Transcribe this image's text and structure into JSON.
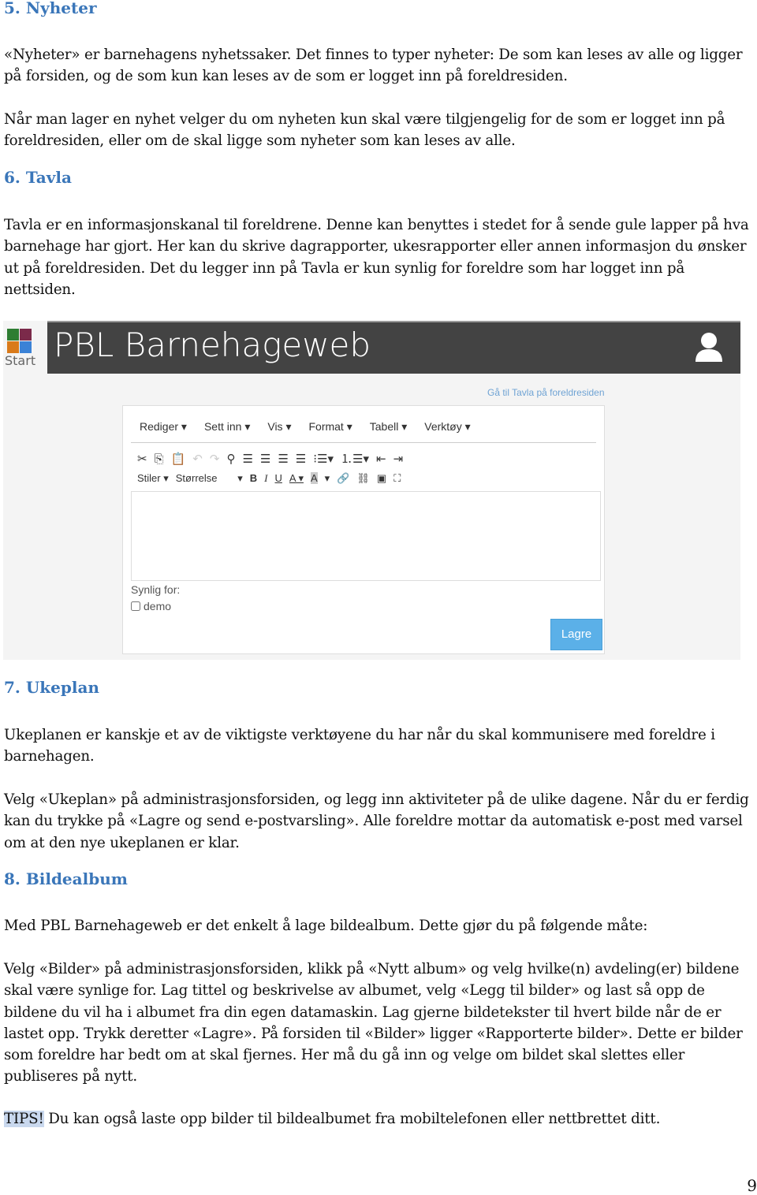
{
  "sections": [
    {
      "heading": "5. Nyheter",
      "paragraphs": [
        "«Nyheter» er barnehagens nyhetssaker. Det finnes to typer nyheter: De som kan leses av alle og ligger på forsiden, og de som kun kan leses av de som er logget inn på foreldresiden.",
        "Når man lager en nyhet velger du om nyheten kun skal være tilgjengelig for de som er logget inn på foreldresiden, eller om de skal ligge som nyheter som kan leses av alle."
      ]
    },
    {
      "heading": "6. Tavla",
      "paragraphs": [
        "Tavla er en informasjonskanal til foreldrene. Denne kan benyttes i stedet for å sende gule lapper på hva barnehage har gjort. Her kan du skrive dagrapporter, ukesrapporter eller annen informasjon du ønsker ut på foreldresiden. Det du legger inn på Tavla er kun synlig for foreldre som har logget inn på nettsiden."
      ]
    },
    {
      "heading": "7. Ukeplan",
      "paragraphs": [
        "Ukeplanen er kanskje et av de viktigste verktøyene du har når du skal kommunisere med foreldre i barnehagen.",
        "Velg «Ukeplan» på administrasjonsforsiden, og legg inn aktiviteter på de ulike dagene. Når du er ferdig kan du trykke på «Lagre og send e-postvarsling». Alle foreldre mottar da automatisk e-post med varsel om at den nye ukeplanen er klar."
      ]
    },
    {
      "heading": "8. Bildealbum",
      "paragraphs": [
        "Med PBL Barnehageweb er det enkelt å lage bildealbum. Dette gjør du på følgende måte:",
        "Velg «Bilder» på administrasjonsforsiden, klikk på «Nytt album» og velg hvilke(n) avdeling(er) bildene skal være synlige for. Lag tittel og beskrivelse av albumet, velg «Legg til bilder» og last så opp de bildene du vil ha i albumet fra din egen datamaskin. Lag gjerne bildetekster til hvert bilde når de er lastet opp. Trykk deretter «Lagre». På forsiden til «Bilder» ligger «Rapporterte bilder». Dette er bilder som foreldre har bedt om at skal fjernes. Her må du gå inn og velge om bildet skal slettes eller publiseres på nytt."
      ]
    }
  ],
  "tips": {
    "label": "TIPS!",
    "text": " Du kan også laste opp bilder til bildealbumet fra mobiltelefonen eller nettbrettet ditt."
  },
  "page_number": "9",
  "screenshot": {
    "start_label": "Start",
    "brand": "PBL Barnehageweb",
    "user_icon": "user-icon",
    "link": "Gå til Tavla på foreldresiden",
    "menu": [
      "Rediger ▾",
      "Sett inn ▾",
      "Vis ▾",
      "Format ▾",
      "Tabell ▾",
      "Verktøy ▾"
    ],
    "styles_label": "Stiler ▾",
    "size_label": "Størrelse",
    "synlig_label": "Synlig for:",
    "checkbox_label": "demo",
    "save_label": "Lagre",
    "logo_colors": [
      "#2e7d32",
      "#7b2a4a",
      "#d97a1a",
      "#3b82d6"
    ],
    "accent": "#5bb0e8"
  }
}
